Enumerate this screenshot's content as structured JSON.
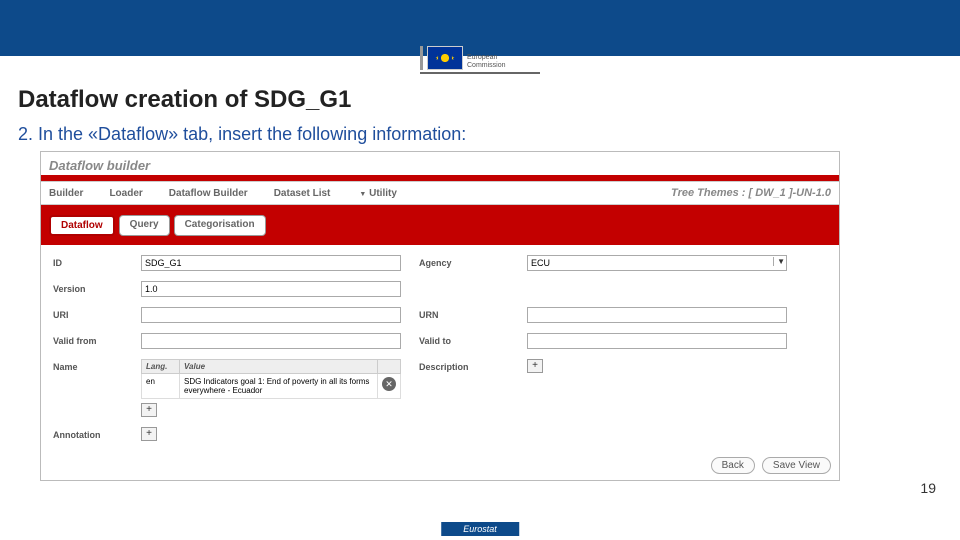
{
  "ec_logo_text1": "European",
  "ec_logo_text2": "Commission",
  "slide": {
    "title": "Dataflow creation of SDG_G1",
    "step": "2. In the «Dataflow» tab, insert the following information:",
    "page_number": "19",
    "footer": "Eurostat"
  },
  "panel": {
    "title": "Dataflow builder",
    "tree_themes": "Tree Themes : [ DW_1 ]-UN-1.0",
    "nav": {
      "builder": "Builder",
      "loader": "Loader",
      "dfbuilder": "Dataflow Builder",
      "dslist": "Dataset List",
      "utility": "Utility"
    },
    "subtabs": {
      "dataflow": "Dataflow",
      "query": "Query",
      "categorisation": "Categorisation"
    },
    "form": {
      "id_label": "ID",
      "id_value": "SDG_G1",
      "agency_label": "Agency",
      "agency_value": "ECU",
      "version_label": "Version",
      "version_value": "1.0",
      "uri_label": "URI",
      "uri_value": "",
      "urn_label": "URN",
      "urn_value": "",
      "validfrom_label": "Valid from",
      "validfrom_value": "",
      "validto_label": "Valid to",
      "validto_value": "",
      "name_label": "Name",
      "desc_label": "Description",
      "annotation_label": "Annotation",
      "name_cols": {
        "lang": "Lang.",
        "value": "Value"
      },
      "name_row": {
        "lang": "en",
        "value": "SDG Indicators goal 1: End of poverty in all its forms everywhere - Ecuador"
      },
      "plus": "+",
      "delete_icon": "✕"
    },
    "buttons": {
      "back": "Back",
      "save_view": "Save View"
    }
  }
}
